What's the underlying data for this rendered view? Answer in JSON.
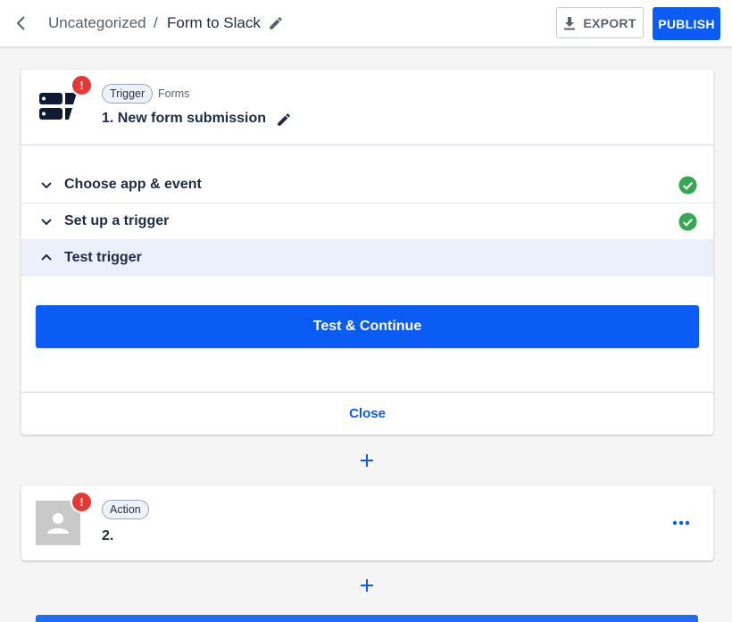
{
  "header": {
    "folder": "Uncategorized",
    "separator": "/",
    "title": "Form to Slack",
    "export_label": "EXPORT",
    "publish_label": "PUBLISH"
  },
  "trigger_step": {
    "chip": "Trigger",
    "app_name": "Forms",
    "title": "1. New form submission",
    "alert": "!",
    "sections": [
      {
        "label": "Choose app & event",
        "status": "complete"
      },
      {
        "label": "Set up a trigger",
        "status": "complete"
      },
      {
        "label": "Test trigger",
        "status": "open"
      }
    ],
    "test_button": "Test & Continue",
    "close_label": "Close"
  },
  "action_step": {
    "chip": "Action",
    "title": "2.",
    "alert": "!"
  },
  "icons": {
    "back": "chevron-left-icon",
    "edit": "pencil-icon",
    "export": "download-icon",
    "check": "check-circle-icon",
    "add": "plus-icon",
    "more": "ellipsis-icon"
  },
  "colors": {
    "primary": "#0b5cf5",
    "success": "#34a853",
    "alert": "#e53935",
    "open_row": "#ebf0fb"
  }
}
